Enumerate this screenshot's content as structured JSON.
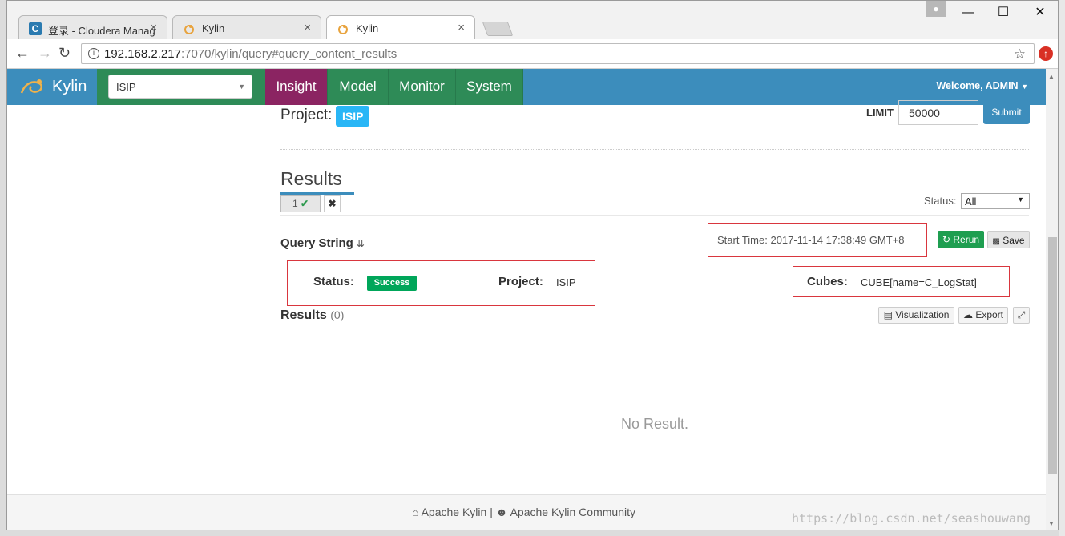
{
  "browser": {
    "tabs": [
      {
        "title": "登录 - Cloudera Manag",
        "close": "×"
      },
      {
        "title": "Kylin",
        "close": "×"
      },
      {
        "title": "Kylin",
        "close": "×"
      }
    ],
    "window_controls": {
      "minimize": "—",
      "maximize": "☐",
      "close": "✕"
    },
    "url_host": "192.168.2.217",
    "url_rest": ":7070/kylin/query#query_content_results"
  },
  "navbar": {
    "brand": "Kylin",
    "project_select": "ISIP",
    "menu": [
      "Insight",
      "Model",
      "Monitor",
      "System"
    ],
    "active_menu": "Insight",
    "welcome": "Welcome, ADMIN"
  },
  "query": {
    "project_label": "Project:",
    "project_badge": "ISIP",
    "limit_label": "LIMIT",
    "limit_value": "50000",
    "submit": "Submit"
  },
  "results": {
    "title": "Results",
    "tab_label": "1",
    "status_label": "Status:",
    "status_filter": "All",
    "query_string_label": "Query String",
    "start_time": "Start Time: 2017-11-14 17:38:49 GMT+8",
    "rerun": "Rerun",
    "save": "Save",
    "status_field_label": "Status:",
    "status_value": "Success",
    "project_field_label": "Project:",
    "project_value": "ISIP",
    "cubes_label": "Cubes:",
    "cubes_value": "CUBE[name=C_LogStat]",
    "results_label": "Results",
    "results_count": "(0)",
    "visualization": "Visualization",
    "export": "Export",
    "no_result": "No Result."
  },
  "footer": {
    "link1": "Apache Kylin",
    "separator": "|",
    "link2": "Apache Kylin Community"
  },
  "watermark": "https://blog.csdn.net/seashouwang"
}
